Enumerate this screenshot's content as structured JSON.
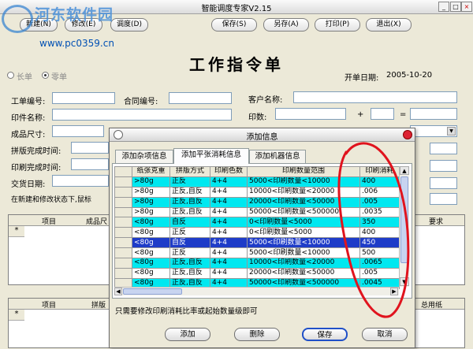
{
  "window": {
    "title": "智能调度专家V2.15"
  },
  "watermark": {
    "text": "河东软件园",
    "url": "www.pc0359.cn"
  },
  "toolbar": {
    "buttons": [
      "新建(N)",
      "修改(E)",
      "调度(D)",
      "保存(S)",
      "另存(A)",
      "打印(P)",
      "退出(X)"
    ]
  },
  "form": {
    "title": "工作指令单",
    "radios": [
      "长单",
      "零单"
    ],
    "date_label": "开单日期:",
    "date_value": "2005-10-20",
    "labels": {
      "work_no": "工单编号:",
      "contract_no": "合同编号:",
      "customer": "客户名称:",
      "part_name": "印件名称:",
      "count": "印数:",
      "plus": "+",
      "equals": "=",
      "size": "成品尺寸:",
      "layout_time": "拼版完成时间:",
      "print_time": "印刷完成时间:",
      "delivery": "交货日期:"
    },
    "note": "在新建和修改状态下,鼠标",
    "grid1": {
      "col1": "项目",
      "col2": "成品尺",
      "col3": "要求"
    },
    "grid2": {
      "col1": "项目",
      "col2": "拼版",
      "col3": "总用纸"
    },
    "row_marker": "*"
  },
  "modal": {
    "title": "添加信息",
    "tabs": [
      "添加杂项信息",
      "添加平张消耗信息",
      "添加机器信息"
    ],
    "columns": [
      "纸张克重",
      "拼版方式",
      "印刷色数",
      "印刷数量范围",
      "印刷消耗"
    ],
    "rows": [
      {
        "weight": ">80g",
        "method": "正反",
        "colors": "4+4",
        "range": "5000<印刷数量<10000",
        "loss": "400",
        "style": "cyan"
      },
      {
        "weight": ">80g",
        "method": "正反,自反",
        "colors": "4+4",
        "range": "10000<印刷数量<20000",
        "loss": ".006",
        "style": "white"
      },
      {
        "weight": ">80g",
        "method": "正反,自反",
        "colors": "4+4",
        "range": "20000<印刷数量<50000",
        "loss": ".005",
        "style": "cyan"
      },
      {
        "weight": ">80g",
        "method": "正反,自反",
        "colors": "4+4",
        "range": "50000<印刷数量<500000",
        "loss": ".0035",
        "style": "white"
      },
      {
        "weight": "<80g",
        "method": "自反",
        "colors": "4+4",
        "range": "0<印刷数量<5000",
        "loss": "350",
        "style": "cyan"
      },
      {
        "weight": "<80g",
        "method": "正反",
        "colors": "4+4",
        "range": "0<印刷数量<5000",
        "loss": "400",
        "style": "white"
      },
      {
        "weight": "<80g",
        "method": "自反",
        "colors": "4+4",
        "range": "5000<印刷数量<10000",
        "loss": "450",
        "style": "blue"
      },
      {
        "weight": "<80g",
        "method": "正反",
        "colors": "4+4",
        "range": "5000<印刷数量<10000",
        "loss": "500",
        "style": "white"
      },
      {
        "weight": "<80g",
        "method": "正反,自反",
        "colors": "4+4",
        "range": "10000<印刷数量<20000",
        "loss": ".0065",
        "style": "cyan"
      },
      {
        "weight": "<80g",
        "method": "正反,自反",
        "colors": "4+4",
        "range": "20000<印刷数量<50000",
        "loss": ".005",
        "style": "white"
      },
      {
        "weight": "<80g",
        "method": "正反,自反",
        "colors": "4+4",
        "range": "50000<印刷数量<500000",
        "loss": ".0045",
        "style": "cyan"
      }
    ],
    "hint": "只需要修改印刷消耗比率或起始数量级即可",
    "buttons": [
      "添加",
      "删除",
      "保存",
      "取消"
    ]
  },
  "colors": {
    "highlight_row": "#00e8f0",
    "selected_row": "#1e3cc8",
    "annotation": "#e0141e"
  }
}
